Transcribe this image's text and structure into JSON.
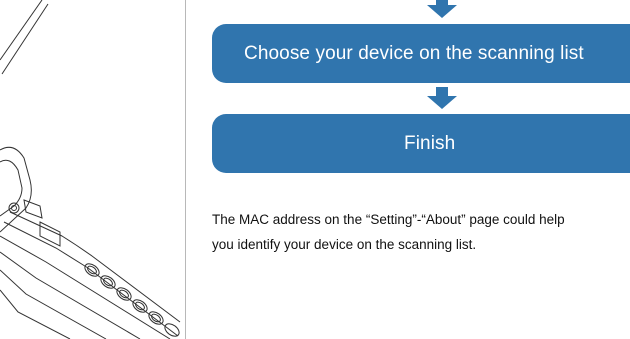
{
  "flow": {
    "steps": [
      "Choose your device on the scanning list",
      "Finish"
    ]
  },
  "note": {
    "line1": "The MAC address on the “Setting”-“About” page could help",
    "line2": "you identify your device on the scanning list."
  },
  "colors": {
    "box_fill": "#3075ae",
    "arrow_fill": "#3075ae",
    "divider": "#b8b8b8"
  }
}
